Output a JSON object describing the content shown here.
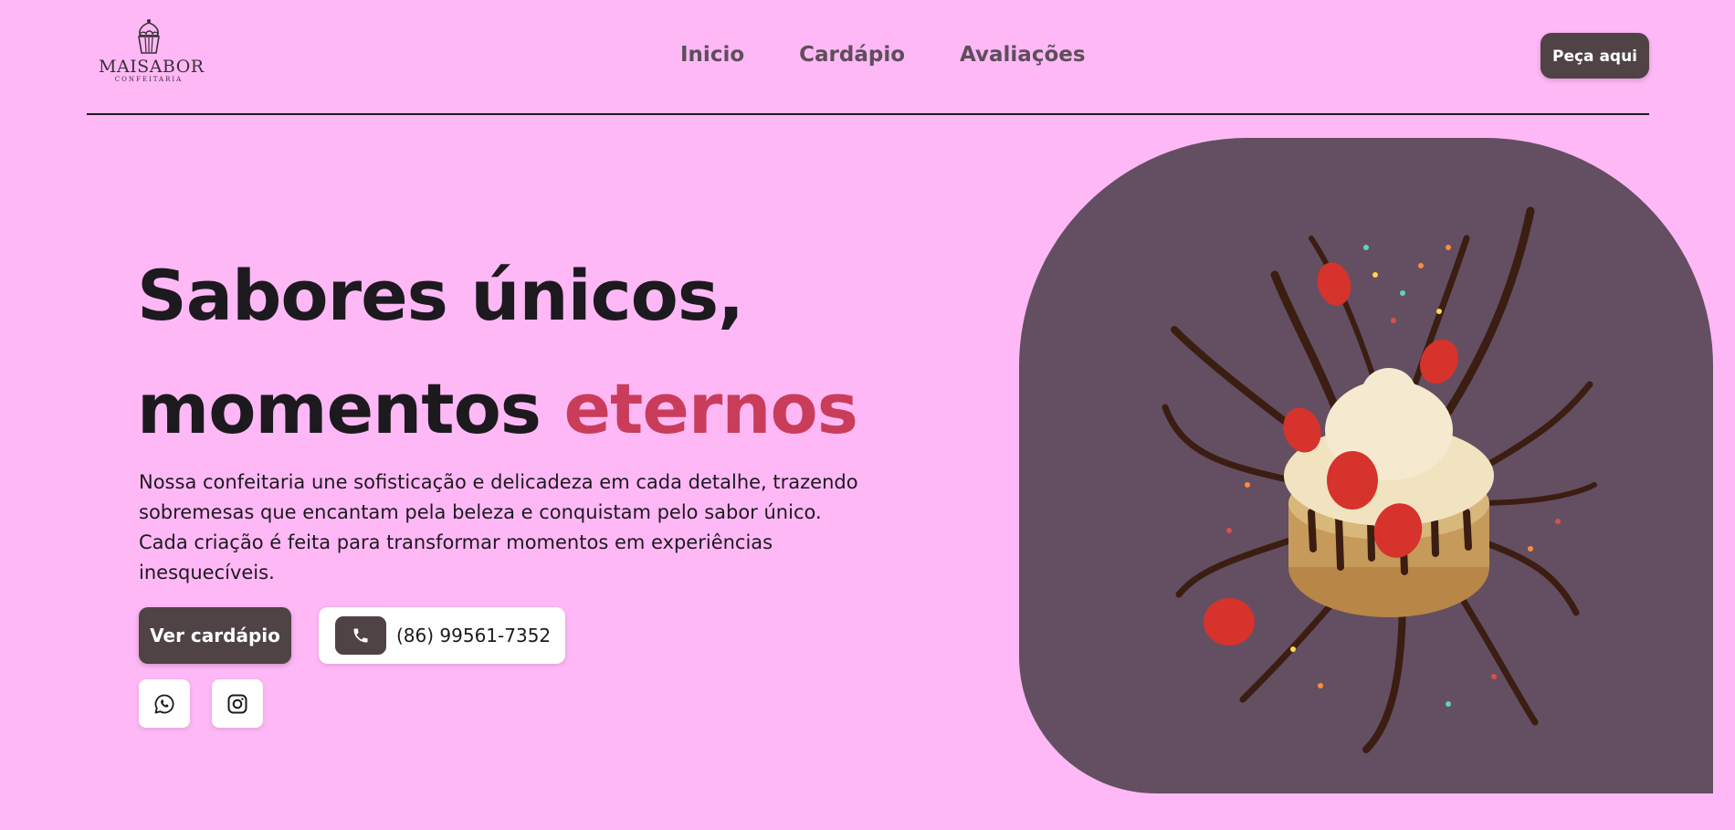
{
  "brand": {
    "name": "MAISABOR",
    "tagline": "CONFEITARIA",
    "logo_icon": "cupcake-icon"
  },
  "nav": {
    "items": [
      {
        "label": "Inicio"
      },
      {
        "label": "Cardápio"
      },
      {
        "label": "Avaliações"
      }
    ]
  },
  "header": {
    "order_label": "Peça aqui"
  },
  "hero": {
    "title_line1": "Sabores únicos,",
    "title_line2_main": "momentos",
    "title_line2_accent": "eternos",
    "description": "Nossa confeitaria une sofisticação e delicadeza em cada detalhe, trazendo sobremesas que encantam pela beleza e conquistam pelo sabor único. Cada criação é feita para transformar momentos em experiências inesquecíveis.",
    "menu_button_label": "Ver cardápio",
    "phone": "(86) 99561-7352",
    "phone_icon": "phone-icon",
    "social": [
      {
        "icon": "whatsapp-icon"
      },
      {
        "icon": "instagram-icon"
      }
    ],
    "image": "cake-with-strawberries-and-chocolate-splash"
  },
  "colors": {
    "background": "#ffb8f6",
    "accent": "#c93d5a",
    "dark_button": "#4f4346",
    "panel": "#634f61",
    "nav_text": "#5e4e5a"
  }
}
